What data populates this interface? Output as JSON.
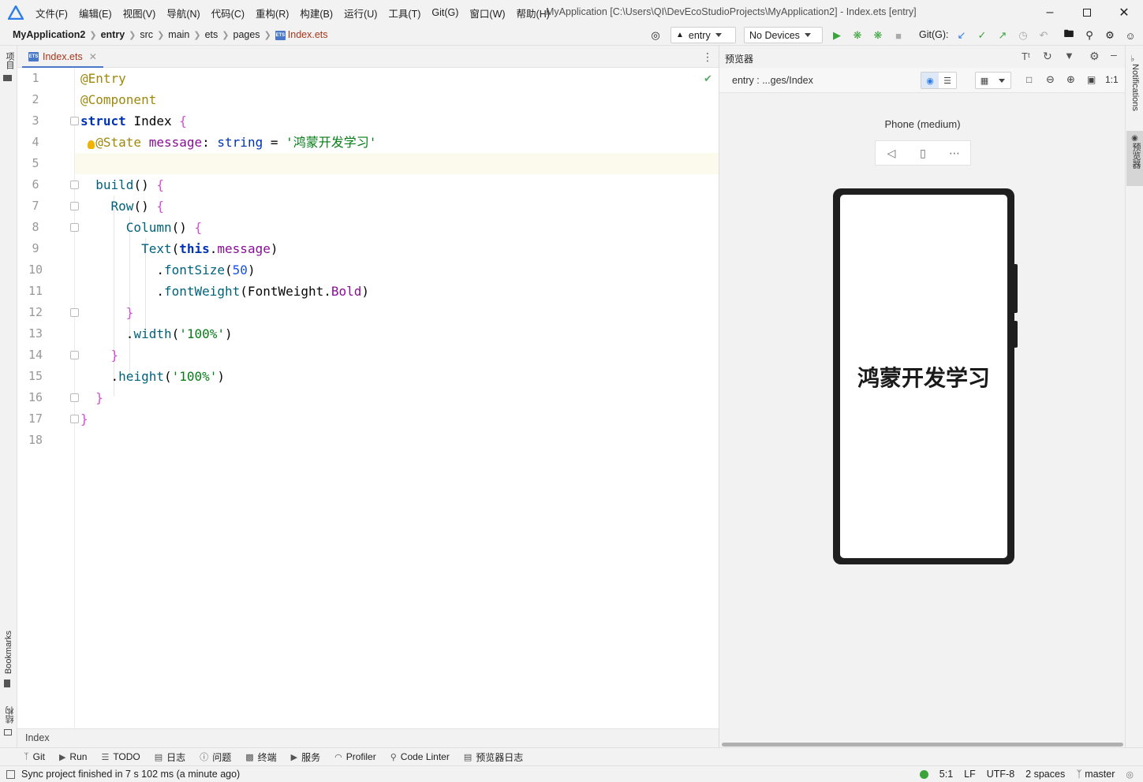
{
  "menu": [
    "文件(F)",
    "编辑(E)",
    "视图(V)",
    "导航(N)",
    "代码(C)",
    "重构(R)",
    "构建(B)",
    "运行(U)",
    "工具(T)",
    "Git(G)",
    "窗口(W)",
    "帮助(H)"
  ],
  "window_title": "MyApplication [C:\\Users\\QI\\DevEcoStudioProjects\\MyApplication2] - Index.ets [entry]",
  "breadcrumb": {
    "project": "MyApplication2",
    "module": "entry",
    "items": [
      "src",
      "main",
      "ets",
      "pages"
    ],
    "file": "Index.ets"
  },
  "toolbar": {
    "module_select": "entry",
    "device_select": "No Devices",
    "git_label": "Git(G):"
  },
  "left_stripe": {
    "project": "项目",
    "bookmarks": "Bookmarks",
    "structure": "结构"
  },
  "editor": {
    "tab": "Index.ets",
    "ets_badge": "ETS",
    "line_numbers": [
      "1",
      "2",
      "3",
      "4",
      "5",
      "6",
      "7",
      "8",
      "9",
      "10",
      "11",
      "12",
      "13",
      "14",
      "15",
      "16",
      "17",
      "18"
    ],
    "footer": "Index"
  },
  "previewer": {
    "title": "预览器",
    "route": "entry : ...ges/Index",
    "device": "Phone (medium)",
    "screen_text": "鸿蒙开发学习",
    "zoom_label": "1:1"
  },
  "right_stripe": {
    "notifications": "Notifications",
    "previewer": "预览器"
  },
  "bottom_tools": [
    {
      "label": "Git",
      "icon": "git-branch-icon"
    },
    {
      "label": "Run",
      "icon": "run-icon"
    },
    {
      "label": "TODO",
      "icon": "list-icon"
    },
    {
      "label": "日志",
      "icon": "log-icon"
    },
    {
      "label": "问题",
      "icon": "problems-icon"
    },
    {
      "label": "终端",
      "icon": "terminal-icon"
    },
    {
      "label": "服务",
      "icon": "services-icon"
    },
    {
      "label": "Profiler",
      "icon": "profiler-icon"
    },
    {
      "label": "Code Linter",
      "icon": "linter-icon"
    },
    {
      "label": "预览器日志",
      "icon": "preview-log-icon"
    }
  ],
  "status": {
    "message": "Sync project finished in 7 s 102 ms (a minute ago)",
    "position": "5:1",
    "line_sep": "LF",
    "encoding": "UTF-8",
    "indent": "2 spaces",
    "branch": "master"
  },
  "colors": {
    "accent": "#4a78c8",
    "file_tab": "#a7361a",
    "run": "#3aa33a"
  }
}
